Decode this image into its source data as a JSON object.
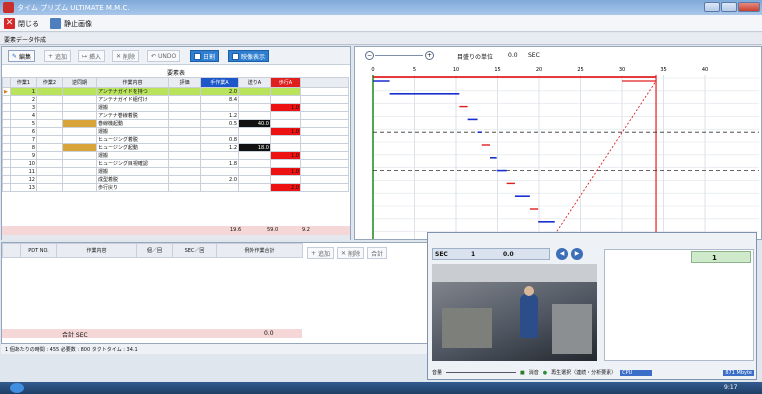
{
  "window": {
    "title": "タイム プリズム ULTIMATE M.M.C."
  },
  "menu": {
    "close_label": "閉じる",
    "still_label": "静止画像"
  },
  "section": {
    "title": "要素データ作成"
  },
  "toolbar": {
    "edit": "編集",
    "add": "追加",
    "insert": "挿入",
    "delete": "削除",
    "undo": "UNDO",
    "daily": "日割",
    "video": "映像表示"
  },
  "table": {
    "caption": "要素表",
    "headers": [
      "作業1",
      "作業2",
      "逆同期",
      "作業内容",
      "評価",
      "手作業A",
      "送りA",
      "歩行A"
    ],
    "rows": [
      {
        "no": "1",
        "content": "アンテナガイドを持つ",
        "handA": "2.0",
        "feedA": "",
        "walkA": ""
      },
      {
        "no": "2",
        "content": "アンテナガイド組付け",
        "handA": "8.4",
        "feedA": "",
        "walkA": ""
      },
      {
        "no": "3",
        "content": "運搬",
        "handA": "",
        "feedA": "",
        "walkA": "1.0"
      },
      {
        "no": "4",
        "content": "アンテナ巻線着脱",
        "handA": "1.2",
        "feedA": "",
        "walkA": ""
      },
      {
        "no": "5",
        "content": "巻線機起動",
        "handA": "0.5",
        "feedA": "40.0",
        "walkA": ""
      },
      {
        "no": "6",
        "content": "運搬",
        "handA": "",
        "feedA": "",
        "walkA": "1.0"
      },
      {
        "no": "7",
        "content": "ヒュージング着脱",
        "handA": "0.8",
        "feedA": "",
        "walkA": ""
      },
      {
        "no": "8",
        "content": "ヒュージング起動",
        "handA": "1.2",
        "feedA": "18.0",
        "walkA": ""
      },
      {
        "no": "9",
        "content": "運搬",
        "handA": "",
        "feedA": "",
        "walkA": "1.0"
      },
      {
        "no": "10",
        "content": "ヒュージング目視確認",
        "handA": "1.8",
        "feedA": "",
        "walkA": ""
      },
      {
        "no": "11",
        "content": "運搬",
        "handA": "",
        "feedA": "",
        "walkA": "1.0"
      },
      {
        "no": "12",
        "content": "成型着脱",
        "handA": "2.0",
        "feedA": "",
        "walkA": ""
      },
      {
        "no": "13",
        "content": "歩行戻り",
        "handA": "",
        "feedA": "",
        "walkA": "2.0"
      }
    ],
    "totals": {
      "handA": "19.6",
      "feedA": "59.0",
      "walkA": "9.2"
    }
  },
  "timeline": {
    "unit_label": "目盛りの単位",
    "unit_value": "0.0",
    "unit_suffix": "SEC",
    "ticks": [
      "0",
      "5",
      "10",
      "15",
      "20",
      "25",
      "30",
      "35",
      "40"
    ]
  },
  "lower": {
    "headers": [
      "PDT NO.",
      "作業内容",
      "個／回",
      "SEC／回",
      "例外作業合計"
    ],
    "total_label": "合計 SEC",
    "total_value": "0.0",
    "btn_add": "追加",
    "btn_del": "削除",
    "btn_total": "合計"
  },
  "status": {
    "text": "1 個あたりの時間 : 455  必要数 : 800  タクトタイム : 34.1"
  },
  "video": {
    "sec_label": "SEC",
    "sec_num": "1",
    "sec_value": "0.0",
    "right_num": "1",
    "volume_label": "音量",
    "mute_label": "消音",
    "playback_label": "再生選択（連続・分析要素）",
    "cpu_label": "CPU",
    "memory": "871 Mbyte"
  },
  "taskbar": {
    "clock": "9:17"
  }
}
